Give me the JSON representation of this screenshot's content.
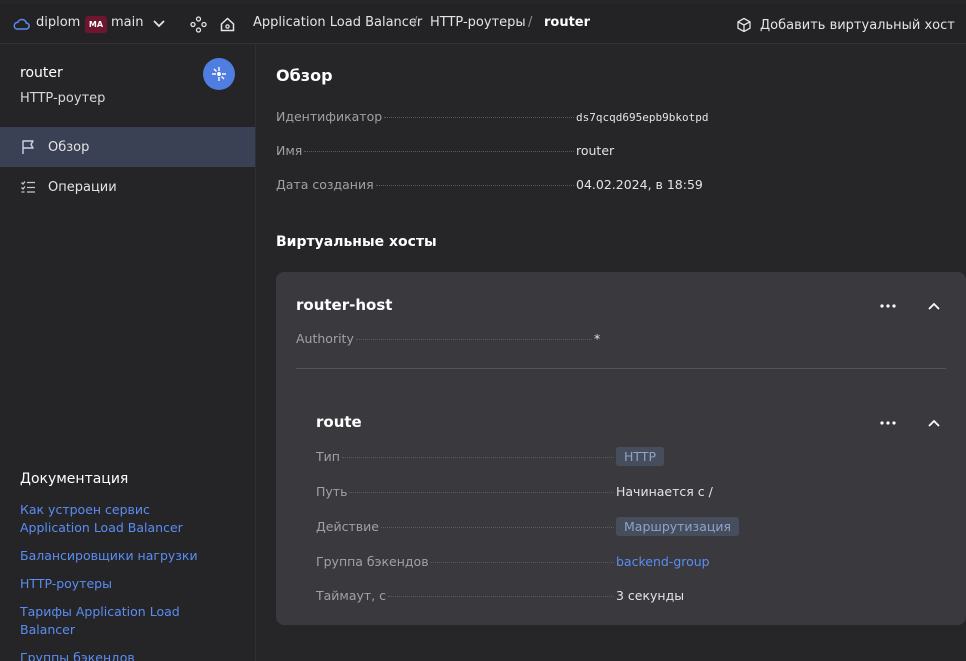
{
  "topbar": {
    "cloud_name": "diplom",
    "folder_badge": "MA",
    "folder_name": "main",
    "breadcrumbs": [
      "Application Load Balancer",
      "HTTP-роутеры",
      "router"
    ],
    "separator": "/",
    "add_host_label": "Добавить виртуальный хост"
  },
  "sidebar": {
    "title": "router",
    "subtitle": "HTTP-роутер",
    "items": [
      {
        "label": "Обзор",
        "icon": "flag-icon",
        "active": true
      },
      {
        "label": "Операции",
        "icon": "list-icon",
        "active": false
      }
    ],
    "docs_title": "Документация",
    "docs_links": [
      "Как устроен сервис Application Load Balancer",
      "Балансировщики нагрузки",
      "HTTP-роутеры",
      "Тарифы Application Load Balancer",
      "Группы бэкендов"
    ]
  },
  "overview": {
    "title": "Обзор",
    "fields": [
      {
        "label": "Идентификатор",
        "value": "ds7qcqd695epb9bkotpd"
      },
      {
        "label": "Имя",
        "value": "router"
      },
      {
        "label": "Дата создания",
        "value": "04.02.2024, в 18:59"
      }
    ]
  },
  "virtual_hosts": {
    "title": "Виртуальные хосты",
    "host": {
      "name": "router-host",
      "authority_label": "Authority",
      "authority_value": "*",
      "route": {
        "name": "route",
        "fields": [
          {
            "label": "Тип",
            "value": "HTTP"
          },
          {
            "label": "Путь",
            "value": "Начинается с /"
          },
          {
            "label": "Действие",
            "value": "Маршрутизация"
          },
          {
            "label": "Группа бэкендов",
            "value": "backend-group"
          },
          {
            "label": "Таймаут, с",
            "value": "3 секунды"
          }
        ]
      }
    }
  },
  "colors": {
    "accent": "#4f7ee0",
    "link": "#5a8df2",
    "folder_badge": "#6e1630",
    "active_item": "#3b4154",
    "card": "#3a3a3e"
  }
}
